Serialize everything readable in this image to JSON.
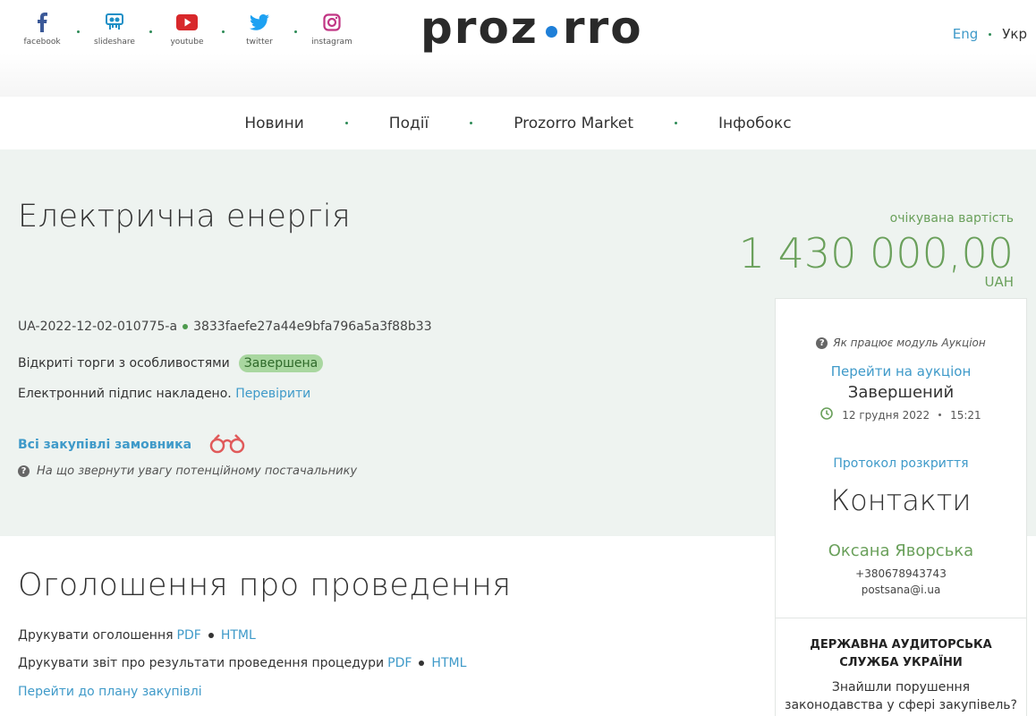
{
  "header": {
    "social": [
      {
        "label": "facebook",
        "icon": "facebook-icon"
      },
      {
        "label": "slideshare",
        "icon": "slideshare-icon"
      },
      {
        "label": "youtube",
        "icon": "youtube-icon"
      },
      {
        "label": "twitter",
        "icon": "twitter-icon"
      },
      {
        "label": "instagram",
        "icon": "instagram-icon"
      }
    ],
    "logo_left": "proz",
    "logo_right": "rro",
    "lang": {
      "eng": "Eng",
      "ukr": "Укр"
    }
  },
  "nav": [
    "Новини",
    "Події",
    "Prozorro Market",
    "Інфобокс"
  ],
  "tender": {
    "title": "Електрична енергія",
    "value_label": "очікувана вартість",
    "value": "1 430 000,00",
    "currency": "UAH",
    "tender_id": "UA-2022-12-02-010775-a",
    "hash": "3833faefe27a44e9bfa796a5a3f88b33",
    "procedure": "Відкриті торги з особливостями",
    "status": "Завершена",
    "sign_text": "Електронний підпис накладено.",
    "sign_link": "Перевірити",
    "all_buyer": "Всі закупівлі замовника",
    "note": "На що звернути увагу потенційному постачальнику"
  },
  "panel": {
    "help": "Як працює модуль Аукціон",
    "auction_link": "Перейти на аукціон",
    "auction_status": "Завершений",
    "date": "12 грудня 2022",
    "time": "15:21",
    "protocol": "Протокол розкриття",
    "contacts_title": "Контакти",
    "contact_name": "Оксана Яворська",
    "phone": "+380678943743",
    "email": "postsana@i.ua",
    "audit_line1": "ДЕРЖАВНА АУДИТОРСЬКА",
    "audit_line2": "СЛУЖБА УКРАЇНИ",
    "violation_line1": "Знайшли порушення",
    "violation_line2": "законодавства у сфері закупівель?"
  },
  "announcement": {
    "title": "Оголошення про проведення",
    "print_notice": "Друкувати оголошення",
    "print_report": "Друкувати звіт про результати проведення процедури",
    "pdf": "PDF",
    "html": "HTML",
    "plan_link": "Перейти до плану закупівлі"
  },
  "colors": {
    "accent_green": "#6aa05b",
    "link_blue": "#3f9ac9",
    "hero_bg": "#eef3f0",
    "badge_bg": "#a9d7a0"
  }
}
